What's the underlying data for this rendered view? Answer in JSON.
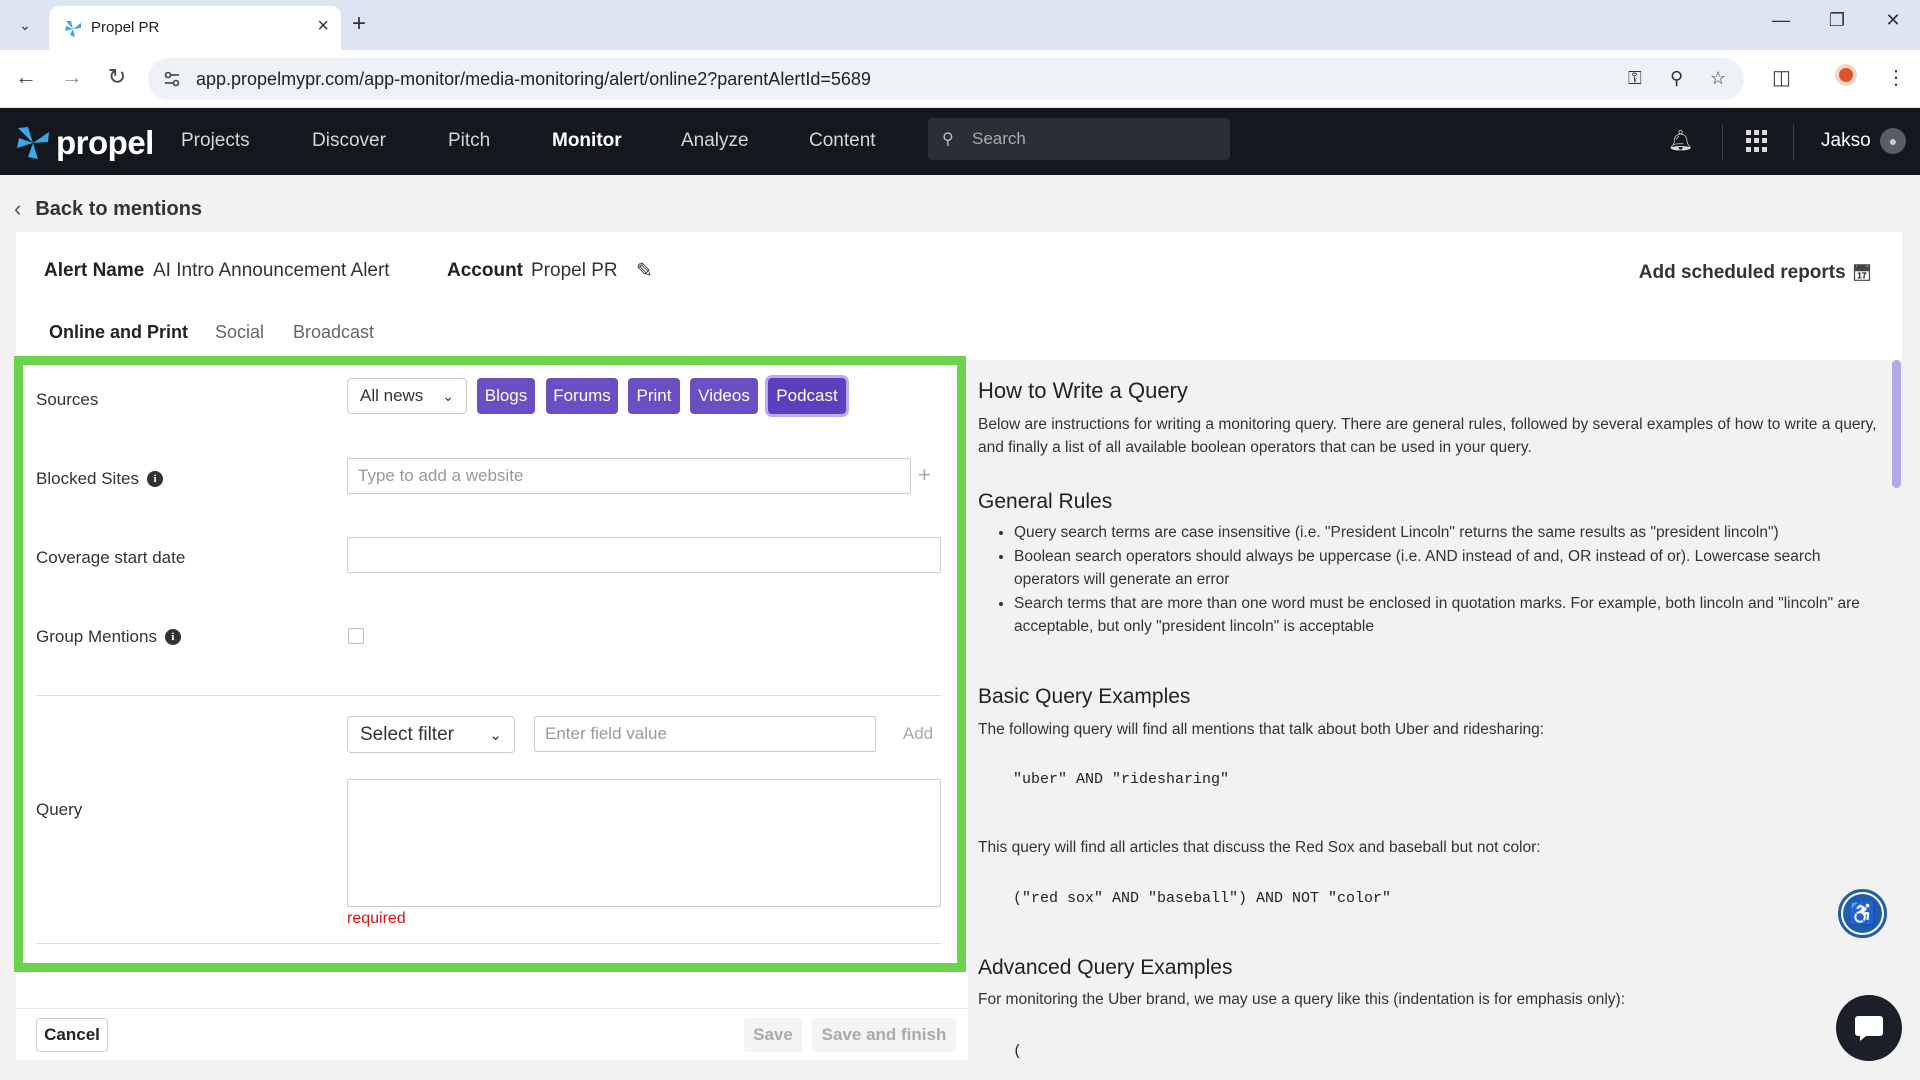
{
  "browser": {
    "tab_title": "Propel PR",
    "url": "app.propelmypr.com/app-monitor/media-monitoring/alert/online2?parentAlertId=5689"
  },
  "nav": {
    "logo": "propel",
    "items": [
      "Projects",
      "Discover",
      "Pitch",
      "Monitor",
      "Analyze",
      "Content"
    ],
    "active": "Monitor",
    "search_placeholder": "Search",
    "user": "Jakso"
  },
  "page": {
    "back_label": "Back to mentions",
    "alert_name_label": "Alert Name",
    "alert_name_value": "AI Intro Announcement Alert",
    "account_label": "Account",
    "account_value": "Propel PR",
    "scheduled_reports": "Add scheduled reports",
    "tabs": [
      "Online and Print",
      "Social",
      "Broadcast"
    ],
    "active_tab": "Online and Print"
  },
  "form": {
    "sources_label": "Sources",
    "sources_select": "All news",
    "source_chips": [
      "Blogs",
      "Forums",
      "Print",
      "Videos",
      "Podcast"
    ],
    "selected_chip": "Podcast",
    "blocked_sites_label": "Blocked Sites",
    "blocked_sites_placeholder": "Type to add a website",
    "coverage_label": "Coverage start date",
    "coverage_value": "",
    "group_mentions_label": "Group Mentions",
    "group_mentions_checked": false,
    "filter_select": "Select filter",
    "field_value_placeholder": "Enter field value",
    "add_label": "Add",
    "query_label": "Query",
    "query_value": "",
    "required_text": "required",
    "cancel": "Cancel",
    "save": "Save",
    "save_finish": "Save and finish"
  },
  "help": {
    "title": "How to Write a Query",
    "intro": "Below are instructions for writing a monitoring query. There are general rules, followed by several examples of how to write a query, and finally a list of all available boolean operators that can be used in your query.",
    "general_title": "General Rules",
    "rules": [
      "Query search terms are case insensitive (i.e. \"President Lincoln\" returns the same results as \"president lincoln\")",
      "Boolean search operators should always be uppercase (i.e. AND instead of and, OR instead of or). Lowercase search operators will generate an error",
      "Search terms that are more than one word must be enclosed in quotation marks. For example, both lincoln and \"lincoln\" are acceptable, but only \"president lincoln\" is acceptable"
    ],
    "basic_title": "Basic Query Examples",
    "basic_intro": "The following query will find all mentions that talk about both Uber and ridesharing:",
    "example1": "\"uber\" AND \"ridesharing\"",
    "example2_intro": "This query will find all articles that discuss the Red Sox and baseball but not color:",
    "example2": "(\"red sox\" AND \"baseball\") AND NOT \"color\"",
    "advanced_title": "Advanced Query Examples",
    "advanced_intro": "For monitoring the Uber brand, we may use a query like this (indentation is for emphasis only):",
    "example3": "("
  },
  "colors": {
    "accent_purple": "#6a4fc4",
    "highlight_green": "#6bd44b",
    "nav_bg": "#15171e",
    "logo_blue": "#3aa7e8"
  }
}
